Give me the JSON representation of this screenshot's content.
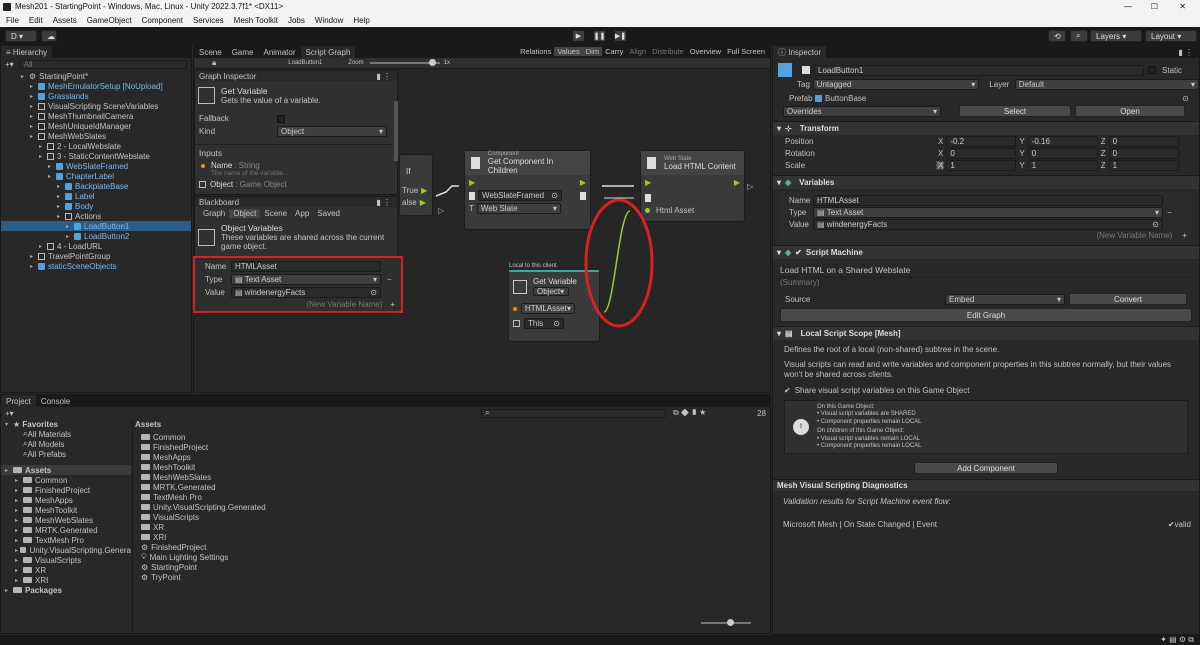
{
  "window": {
    "title": "Mesh201 - StartingPoint - Windows, Mac, Linux - Unity 2022.3.7f1* <DX11>"
  },
  "menu": [
    "File",
    "Edit",
    "Assets",
    "GameObject",
    "Component",
    "Services",
    "Mesh Toolkit",
    "Jobs",
    "Window",
    "Help"
  ],
  "toolbar": {
    "account": "D",
    "layers": "Layers",
    "layout": "Layout"
  },
  "hierarchy": {
    "tab": "Hierarchy",
    "search_placeholder": "All",
    "items": [
      {
        "label": "StartingPoint*",
        "indent": 0,
        "icon": "scene",
        "blue": false,
        "sel": false
      },
      {
        "label": "MeshEmulatorSetup [NoUpload]",
        "indent": 1,
        "icon": "cube",
        "blue": true,
        "sel": false
      },
      {
        "label": "Grasslands",
        "indent": 1,
        "icon": "cube",
        "blue": true,
        "sel": false
      },
      {
        "label": "VisualScripting SceneVariables",
        "indent": 1,
        "icon": "cubeg",
        "blue": false,
        "sel": false
      },
      {
        "label": "MeshThumbnailCamera",
        "indent": 1,
        "icon": "cubeg",
        "blue": false,
        "sel": false
      },
      {
        "label": "MeshUniqueIdManager",
        "indent": 1,
        "icon": "cubeg",
        "blue": false,
        "sel": false
      },
      {
        "label": "MeshWebSlates",
        "indent": 1,
        "icon": "cubeg",
        "blue": false,
        "sel": false
      },
      {
        "label": "2 - LocalWebslate",
        "indent": 2,
        "icon": "cubeg",
        "blue": false,
        "sel": false
      },
      {
        "label": "3 - StaticContentWebslate",
        "indent": 2,
        "icon": "cubeg",
        "blue": false,
        "sel": false
      },
      {
        "label": "WebSlateFramed",
        "indent": 3,
        "icon": "cube",
        "blue": true,
        "sel": false
      },
      {
        "label": "ChapterLabel",
        "indent": 3,
        "icon": "cube",
        "blue": true,
        "sel": false
      },
      {
        "label": "BackplateBase",
        "indent": 4,
        "icon": "cube",
        "blue": true,
        "sel": false
      },
      {
        "label": "Label",
        "indent": 4,
        "icon": "cube",
        "blue": true,
        "sel": false
      },
      {
        "label": "Body",
        "indent": 4,
        "icon": "cube",
        "blue": true,
        "sel": false
      },
      {
        "label": "Actions",
        "indent": 4,
        "icon": "cubeg",
        "blue": false,
        "sel": false
      },
      {
        "label": "LoadButton1",
        "indent": 5,
        "icon": "cube",
        "blue": true,
        "sel": true
      },
      {
        "label": "LoadButton2",
        "indent": 5,
        "icon": "cube",
        "blue": true,
        "sel": false
      },
      {
        "label": "4 - LoadURL",
        "indent": 2,
        "icon": "cubeg",
        "blue": false,
        "sel": false
      },
      {
        "label": "TravelPointGroup",
        "indent": 1,
        "icon": "cubeg",
        "blue": false,
        "sel": false
      },
      {
        "label": "staticSceneObjects",
        "indent": 1,
        "icon": "cube",
        "blue": true,
        "sel": false
      }
    ]
  },
  "scene_tabs": [
    "Scene",
    "Game",
    "Animator",
    "Script Graph"
  ],
  "graph_toolbar": {
    "breadcrumb": "LoadButton1",
    "zoom_label": "Zoom",
    "zoom_value": "1x",
    "buttons": [
      "Relations",
      "Values",
      "Dim",
      "Carry",
      "Align",
      "Distribute",
      "Overview",
      "Full Screen"
    ]
  },
  "graph_inspector": {
    "title": "Graph Inspector",
    "node_title": "Get Variable",
    "node_desc": "Gets the value of a variable.",
    "fallback": "Fallback",
    "kind": "Kind",
    "kind_value": "Object",
    "inputs": "Inputs",
    "name_label": "Name",
    "name_type": ": String",
    "name_desc": "The name of the variable.",
    "object_label": "Object",
    "object_type": ": Game Object"
  },
  "blackboard": {
    "title": "Blackboard",
    "tabs": [
      "Graph",
      "Object",
      "Scene",
      "App",
      "Saved"
    ],
    "section_title": "Object Variables",
    "section_desc": "These variables are shared across the current game object.",
    "name_label": "Name",
    "name_value": "HTMLAsset",
    "type_label": "Type",
    "type_value": "Text Asset",
    "value_label": "Value",
    "value_value": "windenergyFacts",
    "new_var": "(New Variable Name)"
  },
  "nodes": {
    "if": {
      "title": "If",
      "true": "True",
      "false": "alse"
    },
    "component": {
      "kind": "Component",
      "title": "Get Component In Children",
      "target": "WebSlateFramed",
      "type_label": "T",
      "type_value": "Web Slate"
    },
    "webslate": {
      "kind": "Web Slate",
      "title": "Load HTML Content",
      "port": "Html Asset"
    },
    "getvar": {
      "caption": "Local to this client",
      "title": "Get Variable",
      "kind": "Object",
      "name": "HTMLAsset",
      "target": "This"
    }
  },
  "project": {
    "tabs": [
      "Project",
      "Console"
    ],
    "count": "28",
    "favorites": {
      "label": "Favorites",
      "items": [
        "All Materials",
        "All Models",
        "All Prefabs"
      ]
    },
    "assets_tree": [
      "Assets",
      "Common",
      "FinishedProject",
      "MeshApps",
      "MeshToolkit",
      "MeshWebSlates",
      "MRTK.Generated",
      "TextMesh Pro",
      "Unity.VisualScripting.Genera",
      "VisualScripts",
      "XR",
      "XRI",
      "Packages"
    ],
    "assets_header": "Assets",
    "assets_list": [
      {
        "label": "Common",
        "icon": "folder"
      },
      {
        "label": "FinishedProject",
        "icon": "folder"
      },
      {
        "label": "MeshApps",
        "icon": "folder"
      },
      {
        "label": "MeshToolkit",
        "icon": "folder"
      },
      {
        "label": "MeshWebSlates",
        "icon": "folder"
      },
      {
        "label": "MRTK.Generated",
        "icon": "folder"
      },
      {
        "label": "TextMesh Pro",
        "icon": "folder"
      },
      {
        "label": "Unity.VisualScripting.Generated",
        "icon": "folder"
      },
      {
        "label": "VisualScripts",
        "icon": "folder"
      },
      {
        "label": "XR",
        "icon": "folder"
      },
      {
        "label": "XRI",
        "icon": "folder"
      },
      {
        "label": "FinishedProject",
        "icon": "scene"
      },
      {
        "label": "Main Lighting Settings",
        "icon": "light"
      },
      {
        "label": "StartingPoint",
        "icon": "scene"
      },
      {
        "label": "TryPoint",
        "icon": "scene"
      }
    ]
  },
  "inspector": {
    "tab": "Inspector",
    "object_name": "LoadButton1",
    "static": "Static",
    "tag_label": "Tag",
    "tag_value": "Untagged",
    "layer_label": "Layer",
    "layer_value": "Default",
    "prefab_label": "Prefab",
    "prefab_value": "ButtonBase",
    "overrides": "Overrides",
    "select": "Select",
    "open": "Open",
    "transform": {
      "title": "Transform",
      "position": "Position",
      "rotation": "Rotation",
      "scale": "Scale",
      "pos": [
        "-0.2",
        "-0.16",
        "0"
      ],
      "rot": [
        "0",
        "0",
        "0"
      ],
      "scl": [
        "1",
        "1",
        "1"
      ],
      "x": "X",
      "y": "Y",
      "z": "Z"
    },
    "variables": {
      "title": "Variables",
      "name_label": "Name",
      "name_value": "HTMLAsset",
      "type_label": "Type",
      "type_value": "Text Asset",
      "value_label": "Value",
      "value_value": "windenergyFacts",
      "new_var": "(New Variable Name)"
    },
    "script_machine": {
      "title": "Script Machine",
      "graph_title": "Load HTML on a Shared Webslate",
      "summary": "(Summary)",
      "source_label": "Source",
      "source_value": "Embed",
      "convert": "Convert",
      "edit_graph": "Edit Graph"
    },
    "local_scope": {
      "title": "Local Script Scope [Mesh]",
      "desc1": "Defines the root of a local (non-shared) subtree in the scene.",
      "desc2": "Visual scripts can read and write variables and component properties in this subtree normally, but their values won't be shared across clients.",
      "share": "Share visual script variables on this Game Object",
      "info1": "On this Game Object:",
      "info2": "• Visual script variables are SHARED",
      "info3": "• Component properties remain LOCAL",
      "info4": "On children of this Game Object:",
      "info5": "• Visual script variables remain LOCAL",
      "info6": "• Component properties remain LOCAL"
    },
    "add_component": "Add Component",
    "diagnostics": {
      "title": "Mesh Visual Scripting Diagnostics",
      "desc": "Validation results for Script Machine event flow:",
      "result": "Microsoft Mesh | On State Changed | Event",
      "status": "valid"
    }
  },
  "colors": {
    "accent": "#2c5d87",
    "highlight": "#d92121",
    "flow": "#9acd32"
  }
}
